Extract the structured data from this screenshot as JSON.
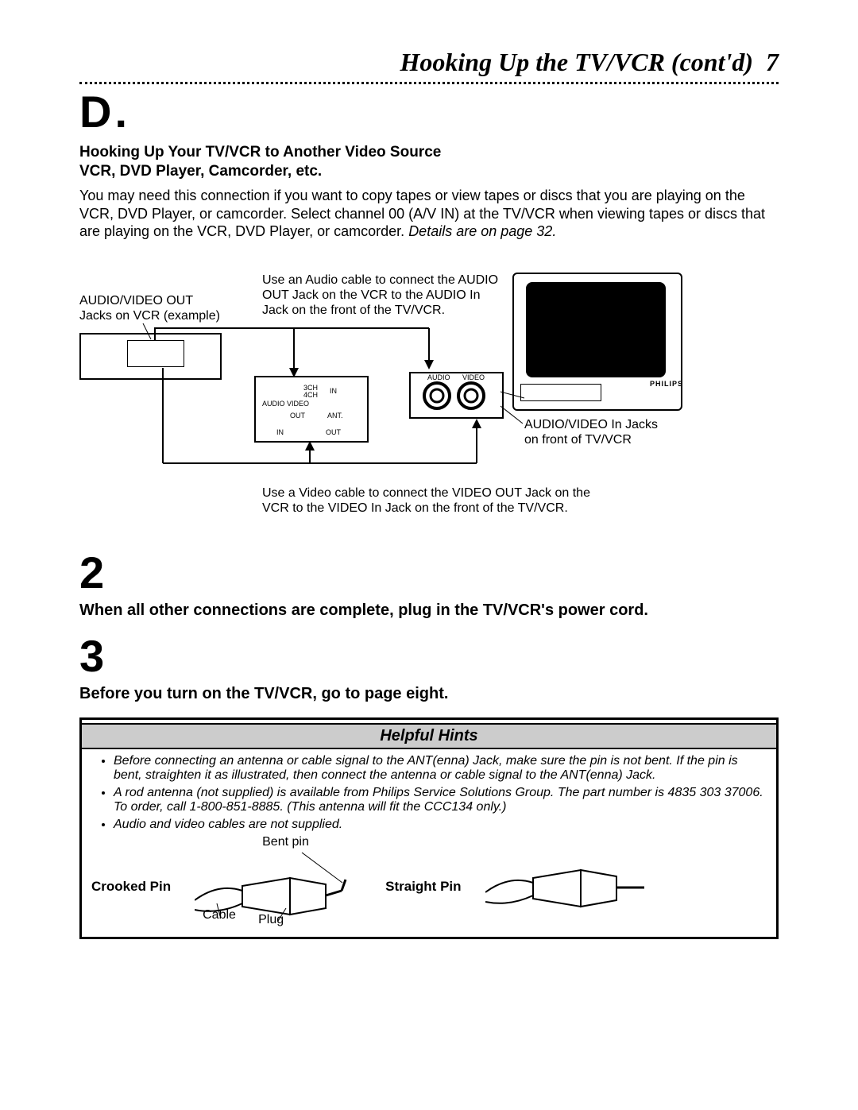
{
  "header": {
    "title": "Hooking Up the TV/VCR (cont'd)",
    "pagenum": "7"
  },
  "section_letter": "D.",
  "subhead1": "Hooking Up Your TV/VCR to Another Video Source",
  "subhead2": "VCR, DVD Player, Camcorder, etc.",
  "intro_plain": "You may need this connection if you want to copy tapes or view tapes or discs that you are playing on the VCR, DVD Player, or camcorder. Select channel 00 (A/V IN) at the TV/VCR when viewing tapes or discs that are playing on the VCR, DVD Player, or camcorder. ",
  "intro_ital": "Details are on page 32.",
  "diagram": {
    "top_left_l1": "AUDIO/VIDEO OUT",
    "top_left_l2": "Jacks on VCR (example)",
    "top_mid": "Use an Audio cable to connect the AUDIO OUT Jack on the VCR to the AUDIO In Jack on the front of the TV/VCR.",
    "right_l1": "AUDIO/VIDEO In Jacks",
    "right_l2": "on front of TV/VCR",
    "bottom": "Use a Video cable to connect the VIDEO OUT Jack on the VCR to the VIDEO In Jack on the front of the TV/VCR.",
    "panel_3ch": "3CH",
    "panel_4ch": "4CH",
    "panel_in": "IN",
    "panel_in2": "IN",
    "panel_out": "OUT",
    "panel_out2": "OUT",
    "panel_ant": "ANT.",
    "panel_audio": "AUDIO",
    "panel_video": "VIDEO",
    "jack_audio": "AUDIO",
    "jack_video": "VIDEO",
    "brand": "PHILIPS"
  },
  "step2_num": "2",
  "step2_text": "When all other connections are complete, plug in the TV/VCR's power cord.",
  "step3_num": "3",
  "step3_text": "Before you turn on the TV/VCR, go to page eight.",
  "hints": {
    "title": "Helpful Hints",
    "b1": "Before connecting an antenna or cable signal to the ANT(enna) Jack, make sure the pin is not bent. If the pin is bent, straighten it as illustrated, then connect the antenna or cable signal to the ANT(enna) Jack.",
    "b2": "A rod antenna (not supplied) is available from Philips Service Solutions Group. The part number is 4835 303 37006. To order, call 1-800-851-8885. (This antenna will fit the CCC134 only.)",
    "b3": "Audio and video cables are not supplied.",
    "crooked": "Crooked Pin",
    "straight": "Straight Pin",
    "bent": "Bent pin",
    "cable": "Cable",
    "plug": "Plug"
  }
}
